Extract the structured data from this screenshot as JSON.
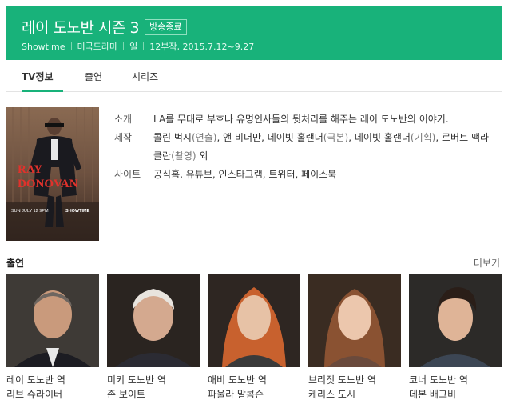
{
  "header": {
    "title": "레이 도노반 시즌 3",
    "badge": "방송종료",
    "network": "Showtime",
    "genre": "미국드라마",
    "day": "일",
    "episodes": "12부작, 2015.7.12~9.27"
  },
  "tabs": [
    {
      "label": "TV정보",
      "active": true
    },
    {
      "label": "출연",
      "active": false
    },
    {
      "label": "시리즈",
      "active": false
    }
  ],
  "poster": {
    "title_line1": "RAY",
    "title_line2": "DONOVAN",
    "tagline": "SUN JULY 12 9PM",
    "network_logo": "SHOWTIME"
  },
  "info": {
    "summary_label": "소개",
    "summary": "LA를 무대로 부호나 유명인사들의 뒷처리를 해주는 레이 도노반의 이야기.",
    "production_label": "제작",
    "production": [
      {
        "name": "콜린 벅시",
        "role": "(연출)"
      },
      {
        "name": "앤 비더만",
        "role": ""
      },
      {
        "name": "데이빗 홀랜더",
        "role": "(극본)"
      },
      {
        "name": "데이빗 홀랜더",
        "role": "(기획)"
      },
      {
        "name": "로버트 맥라클란",
        "role": "(촬영)"
      }
    ],
    "production_suffix": " 외",
    "sites_label": "사이트",
    "sites": [
      "공식홈",
      "유튜브",
      "인스타그램",
      "트위터",
      "페이스북"
    ]
  },
  "cast_section": {
    "title": "출연",
    "more": "더보기"
  },
  "cast": [
    {
      "role": "레이 도노반 역",
      "name": "리브 슈라이버"
    },
    {
      "role": "미키 도노반 역",
      "name": "존 보이트"
    },
    {
      "role": "애비 도노반 역",
      "name": "파울라 말콤슨"
    },
    {
      "role": "브리짓 도노반 역",
      "name": "케리스 도시"
    },
    {
      "role": "코너 도노반 역",
      "name": "데본 배그비"
    }
  ],
  "colors": {
    "accent": "#18b27a"
  }
}
